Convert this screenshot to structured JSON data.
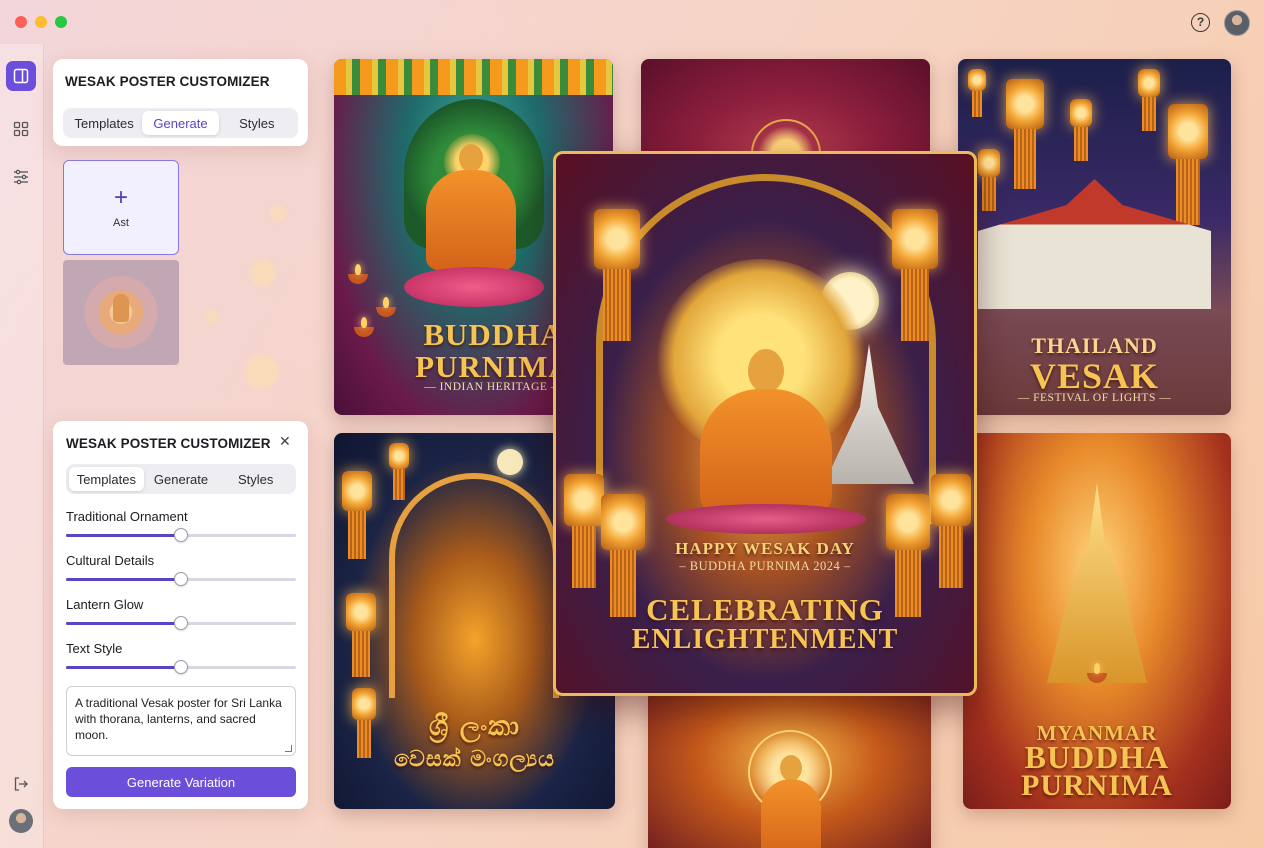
{
  "app": {
    "help_icon": "help-icon",
    "avatar": "avatar"
  },
  "rail": {
    "items": [
      "panel-toggle-icon",
      "grid-icon",
      "sliders-icon"
    ],
    "logout_icon": "logout-icon"
  },
  "top_panel": {
    "title": "WESAK POSTER CUSTOMIZER",
    "tabs": [
      "Templates",
      "Generate",
      "Styles"
    ],
    "active_tab": "Generate"
  },
  "asset_card": {
    "plus": "+",
    "label": "Ast"
  },
  "bottom_panel": {
    "title": "WESAK POSTER CUSTOMIZER",
    "close": "✕",
    "tabs": [
      "Templates",
      "Generate",
      "Styles"
    ],
    "active_tab": "Templates",
    "sliders": [
      {
        "label": "Traditional Ornament",
        "value": 0.5
      },
      {
        "label": "Cultural Details",
        "value": 0.5
      },
      {
        "label": "Lantern Glow",
        "value": 0.5
      },
      {
        "label": "Text Style",
        "value": 0.5
      }
    ],
    "prompt": "A traditional Vesak poster for Sri Lanka with thorana, lanterns, and sacred moon.",
    "button": "Generate Variation"
  },
  "posters": {
    "india": {
      "line1": "BUDDHA",
      "line2": "PURNIMA",
      "sub": "— INDIAN HERITAGE —"
    },
    "thailand": {
      "line1": "THAILAND",
      "line2": "VESAK",
      "sub": "— FESTIVAL OF LIGHTS —"
    },
    "srilanka": {
      "line1": "ශ්‍රී ලංකා",
      "line2": "වෙසක් මංගල්‍යය"
    },
    "myanmar": {
      "line1": "MYANMAR",
      "line2": "BUDDHA",
      "line3": "PURNIMA"
    },
    "featured": {
      "line1": "HAPPY WESAK DAY",
      "line2": "– BUDDHA PURNIMA 2024 –",
      "line3": "CELEBRATING",
      "line4": "ENLIGHTENMENT"
    }
  },
  "colors": {
    "accent": "#6b4fdb",
    "gold": "#f6c452",
    "maroon": "#5a0f22"
  }
}
